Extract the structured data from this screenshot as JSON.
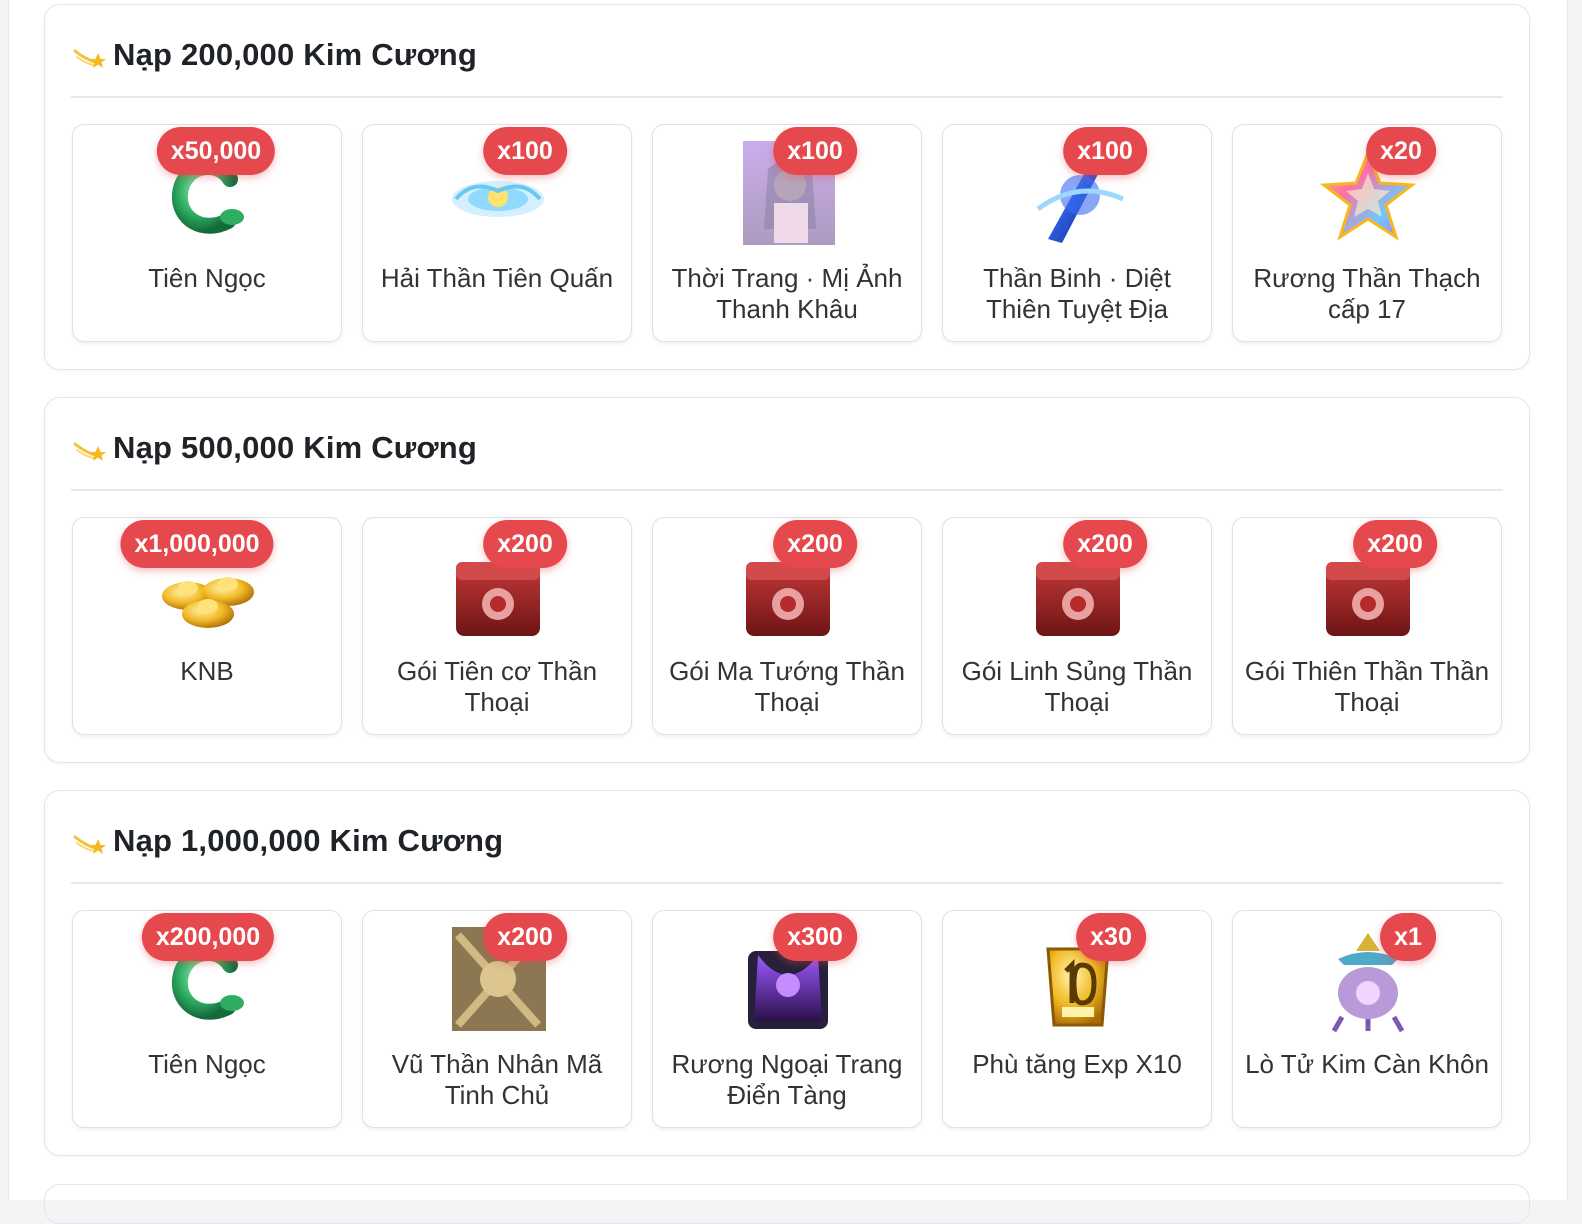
{
  "sections": [
    {
      "icon": "comet-star-icon",
      "title": "Nạp 200,000 Kim Cương",
      "items": [
        {
          "qty": "x50,000",
          "name": "Tiên Ngọc",
          "icon": "jade-dragon-icon"
        },
        {
          "qty": "x100",
          "name": "Hải Thần Tiên Quấn",
          "icon": "ornament-icon"
        },
        {
          "qty": "x100",
          "name": "Thời Trang · Mị Ảnh Thanh Khâu",
          "icon": "character-portrait-icon"
        },
        {
          "qty": "x100",
          "name": "Thần Binh · Diệt Thiên Tuyệt Địa",
          "icon": "weapon-icon"
        },
        {
          "qty": "x20",
          "name": "Rương Thần Thạch cấp 17",
          "icon": "rainbow-star-icon"
        }
      ]
    },
    {
      "icon": "comet-star-icon",
      "title": "Nạp 500,000 Kim Cương",
      "items": [
        {
          "qty": "x1,000,000",
          "name": "KNB",
          "icon": "gold-ingot-icon"
        },
        {
          "qty": "x200",
          "name": "Gói Tiên cơ Thần Thoại",
          "icon": "red-chest-icon"
        },
        {
          "qty": "x200",
          "name": "Gói Ma Tướng Thần Thoại",
          "icon": "red-chest-icon"
        },
        {
          "qty": "x200",
          "name": "Gói Linh Sủng Thần Thoại",
          "icon": "red-chest-icon"
        },
        {
          "qty": "x200",
          "name": "Gói Thiên Thần Thần Thoại",
          "icon": "red-chest-icon"
        }
      ]
    },
    {
      "icon": "comet-star-icon",
      "title": "Nạp 1,000,000 Kim Cương",
      "items": [
        {
          "qty": "x200,000",
          "name": "Tiên Ngọc",
          "icon": "jade-dragon-icon"
        },
        {
          "qty": "x200",
          "name": "Vũ Thần Nhân Mã Tinh Chủ",
          "icon": "armor-icon"
        },
        {
          "qty": "x300",
          "name": "Rương Ngoại Trang Điển Tàng",
          "icon": "purple-chest-icon"
        },
        {
          "qty": "x30",
          "name": "Phù tăng Exp X10",
          "icon": "exp-talisman-icon"
        },
        {
          "qty": "x1",
          "name": "Lò Tử Kim Càn Khôn",
          "icon": "furnace-icon"
        }
      ]
    }
  ],
  "colors": {
    "badge": "#e5484d",
    "title": "#1f2328",
    "text": "#333333",
    "border": "#dfe1e5"
  }
}
